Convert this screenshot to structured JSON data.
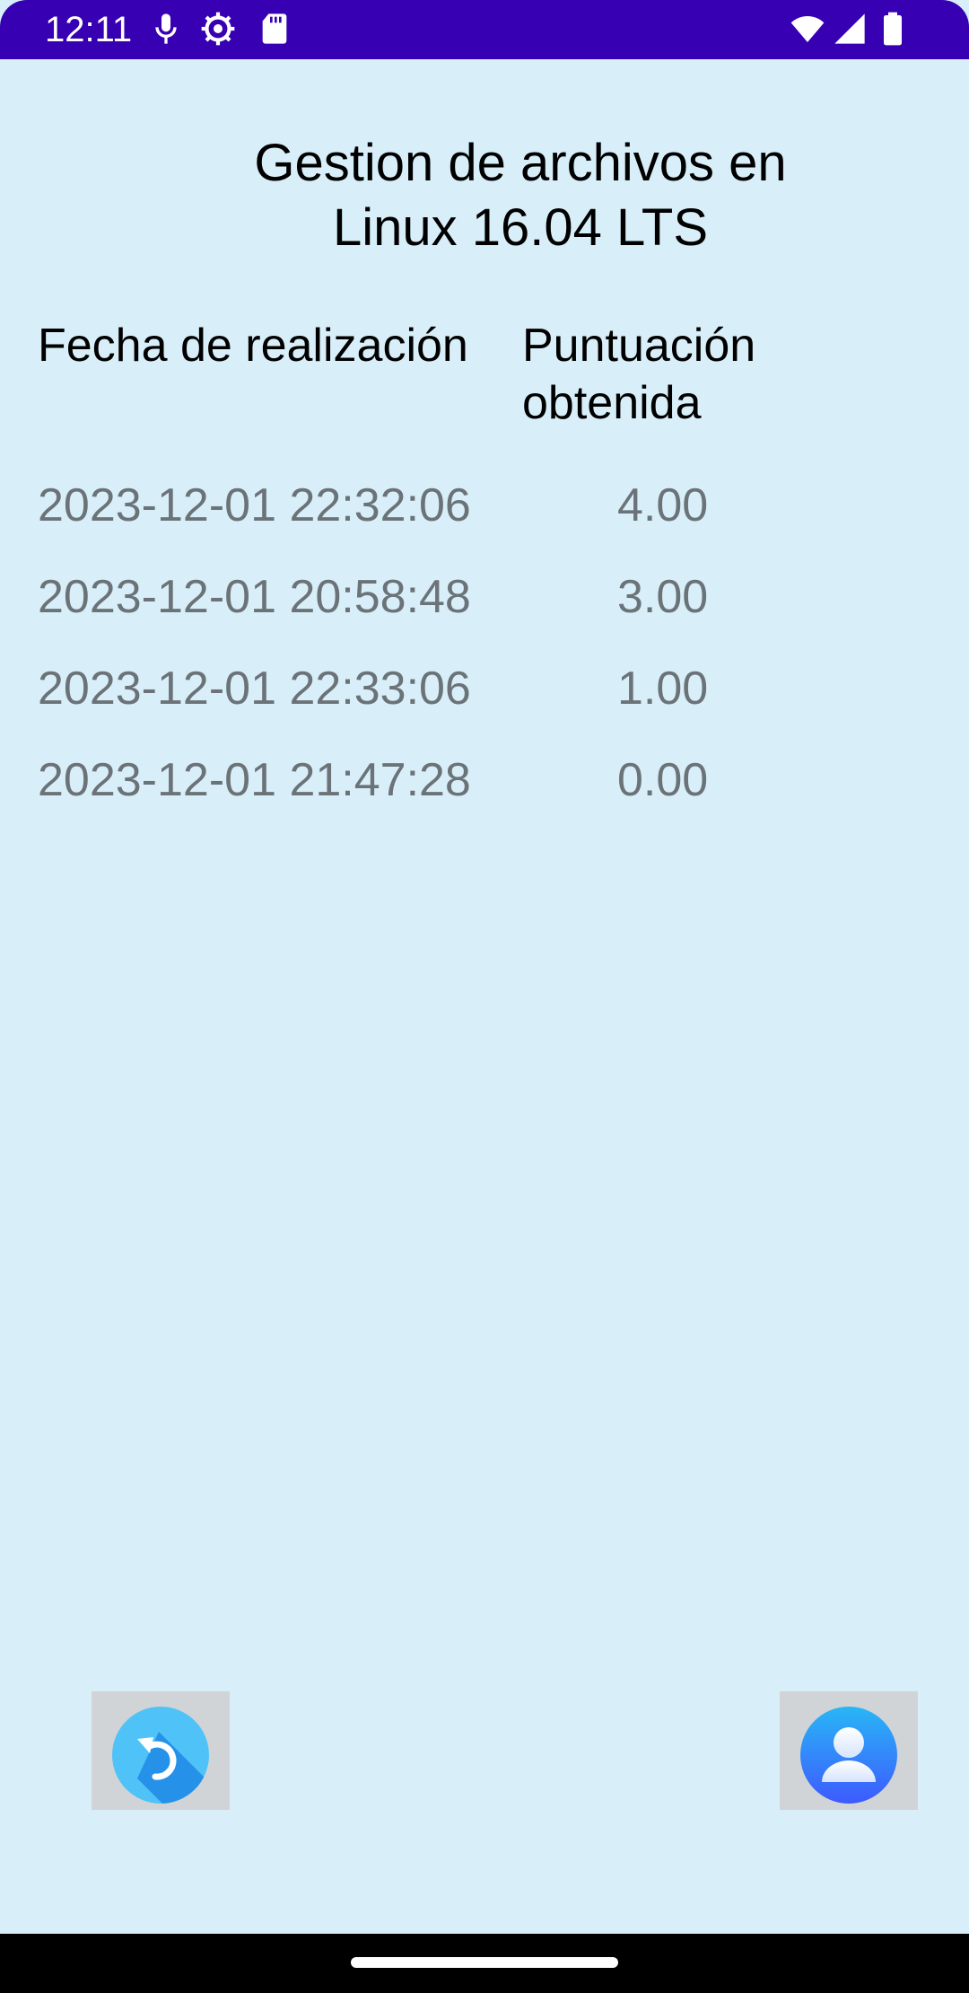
{
  "status_bar": {
    "time": "12:11",
    "icons": [
      "microphone-icon",
      "gear-icon",
      "sd-card-icon",
      "wifi-icon",
      "cellular-signal-icon",
      "battery-icon"
    ],
    "background": "#3700b3"
  },
  "page": {
    "title_line1": "Gestion de archivos en",
    "title_line2": "Linux 16.04 LTS",
    "background": "#d8eff9"
  },
  "table": {
    "headers": {
      "date": "Fecha de realización",
      "score_line1": "Puntuación",
      "score_line2": "obtenida"
    },
    "rows": [
      {
        "date": "2023-12-01 22:32:06",
        "score": "4.00"
      },
      {
        "date": "2023-12-01 20:58:48",
        "score": "3.00"
      },
      {
        "date": "2023-12-01 22:33:06",
        "score": "1.00"
      },
      {
        "date": "2023-12-01 21:47:28",
        "score": "0.00"
      }
    ]
  },
  "actions": {
    "back_icon": "back-arrow-icon",
    "profile_icon": "user-profile-icon"
  }
}
